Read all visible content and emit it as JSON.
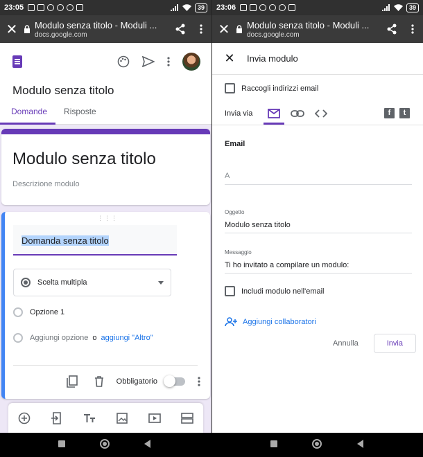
{
  "left": {
    "status": {
      "time": "23:05",
      "battery": "39"
    },
    "browser": {
      "page_title": "Modulo senza titolo - Moduli ...",
      "host": "docs.google.com"
    },
    "header": {
      "title": "Modulo senza titolo",
      "tabs": [
        "Domande",
        "Risposte"
      ]
    },
    "form": {
      "title": "Modulo senza titolo",
      "description_placeholder": "Descrizione modulo"
    },
    "question": {
      "title": "Domanda senza titolo",
      "type": "Scelta multipla",
      "option1": "Opzione 1",
      "add_option": "Aggiungi opzione",
      "or": "o",
      "add_other": "aggiungi \"Altro\"",
      "required_label": "Obbligatorio"
    }
  },
  "right": {
    "status": {
      "time": "23:06",
      "battery": "39"
    },
    "browser": {
      "page_title": "Modulo senza titolo - Moduli ...",
      "host": "docs.google.com"
    },
    "dialog": {
      "title": "Invia modulo",
      "collect_emails": "Raccogli indirizzi email",
      "send_via": "Invia via",
      "section": "Email",
      "to_placeholder": "A",
      "subject_label": "Oggetto",
      "subject_value": "Modulo senza titolo",
      "message_label": "Messaggio",
      "message_value": "Ti ho invitato a compilare un modulo:",
      "include_form": "Includi modulo nell'email",
      "add_collaborators": "Aggiungi collaboratori",
      "cancel": "Annulla",
      "send": "Invia"
    }
  },
  "colors": {
    "accent": "#673ab7",
    "link": "#1a73e8",
    "question_border": "#4285f4"
  }
}
